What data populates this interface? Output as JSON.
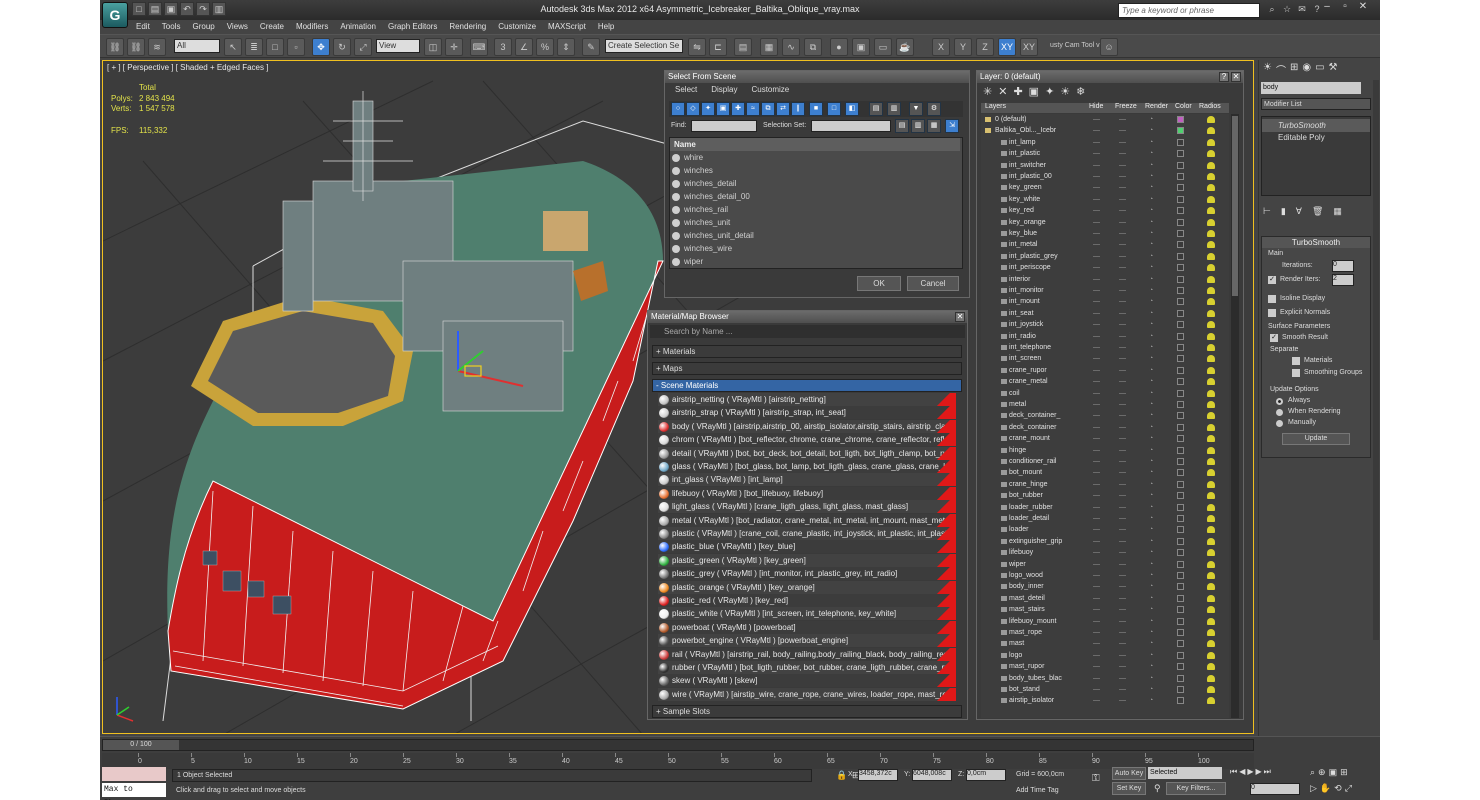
{
  "app": {
    "title": "Autodesk 3ds Max  2012 x64    Asymmetric_Icebreaker_Baltika_Oblique_vray.max",
    "search_placeholder": "Type a keyword or phrase",
    "logo": "3ds-max-logo"
  },
  "menu": [
    "Edit",
    "Tools",
    "Group",
    "Views",
    "Create",
    "Modifiers",
    "Animation",
    "Graph Editors",
    "Rendering",
    "Customize",
    "MAXScript",
    "Help"
  ],
  "toolbar": {
    "filter": "All",
    "view": "View",
    "selection_set": "Create Selection Se",
    "cam_tool": "usty Cam Tool v"
  },
  "viewport": {
    "label": "[ + ] [ Perspective ] [ Shaded + Edged Faces ]",
    "total_label": "Total",
    "polys_label": "Polys:",
    "polys": "2 843 494",
    "verts_label": "Verts:",
    "verts": "1 547 578",
    "fps_label": "FPS:",
    "fps": "115,332"
  },
  "select_from_scene": {
    "title": "Select From Scene",
    "menus": [
      "Select",
      "Display",
      "Customize"
    ],
    "find_label": "Find:",
    "selection_set_label": "Selection Set:",
    "column": "Name",
    "items": [
      "whire",
      "winches",
      "winches_detail",
      "winches_detail_00",
      "winches_rail",
      "winches_unit",
      "winches_unit_detail",
      "winches_wire",
      "wiper"
    ],
    "ok": "OK",
    "cancel": "Cancel"
  },
  "material_browser": {
    "title": "Material/Map Browser",
    "search": "Search by Name ...",
    "groups": [
      "+ Materials",
      "+ Maps",
      "- Scene Materials"
    ],
    "items": [
      "airstrip_netting  ( VRayMtl ) [airstrip_netting]",
      "airstrip_strap  ( VRayMtl ) [airstrip_strap, int_seat]",
      "body  ( VRayMtl ) [airstrip,airstrip_00, airstip_isolator,airstip_stairs, airstrip_clam...",
      "chrom  ( VRayMtl ) [bot_reflector, chrome, crane_chrome, crane_reflector, refle...",
      "detail  ( VRayMtl ) [bot, bot_deck, bot_detail, bot_ligth, bot_ligth_clamp, bot_ru...",
      "glass  ( VRayMtl ) [bot_glass, bot_lamp, bot_ligth_glass, crane_glass, crane_lam...",
      "int_glass  ( VRayMtl ) [int_lamp]",
      "lifebuoy  ( VRayMtl ) [bot_lifebuoy, lifebuoy]",
      "light_glass  ( VRayMtl ) [crane_ligth_glass, light_glass, mast_glass]",
      "metal  ( VRayMtl ) [bot_radiator, crane_metal, int_metal, int_mount, mast_meta...",
      "plastic  ( VRayMtl ) [crane_coil, crane_plastic, int_joystick, int_plastic, int_plastic...",
      "plastic_blue  ( VRayMtl ) [key_blue]",
      "plastic_green  ( VRayMtl ) [key_green]",
      "plastic_grey  ( VRayMtl ) [int_monitor, int_plastic_grey, int_radio]",
      "plastic_orange  ( VRayMtl ) [key_orange]",
      "plastic_red  ( VRayMtl ) [key_red]",
      "plastic_white  ( VRayMtl ) [int_screen, int_telephone, key_white]",
      "powerboat  ( VRayMtl ) [powerboat]",
      "powerbot_engine  ( VRayMtl ) [powerboat_engine]",
      "rail  ( VRayMtl ) [airstrip_rail, body_railing,body_railing_black, body_railing_red,...",
      "rubber  ( VRayMtl ) [bot_ligth_rubber, bot_rubber, crane_ligth_rubber, crane_ru...",
      "skew  ( VRayMtl ) [skew]",
      "wire  ( VRayMtl ) [airstip_wire, crane_rope, crane_wires, loader_rope, mast_rop..."
    ],
    "sample_slots": "+ Sample Slots"
  },
  "layer_manager": {
    "title": "Layer: 0 (default)",
    "columns": [
      "Layers",
      "Hide",
      "Freeze",
      "Render",
      "Color",
      "Radios"
    ],
    "root": [
      "0 (default)",
      "Baltika_Obl..._Icebr"
    ],
    "items": [
      "int_lamp",
      "int_plastic",
      "int_switcher",
      "int_plastic_00",
      "key_green",
      "key_white",
      "key_red",
      "key_orange",
      "key_blue",
      "int_metal",
      "int_plastic_grey",
      "int_periscope",
      "interior",
      "int_monitor",
      "int_mount",
      "int_seat",
      "int_joystick",
      "int_radio",
      "int_telephone",
      "int_screen",
      "crane_rupor",
      "crane_metal",
      "coil",
      "metal",
      "deck_container_",
      "deck_container",
      "crane_mount",
      "hinge",
      "conditioner_rail",
      "bot_mount",
      "crane_hinge",
      "bot_rubber",
      "loader_rubber",
      "loader_detail",
      "loader",
      "extinguisher_grip",
      "lifebuoy",
      "wiper",
      "logo_wood",
      "body_inner",
      "mast_deteil",
      "mast_stairs",
      "lifebuoy_mount",
      "mast_rope",
      "mast",
      "logo",
      "mast_rupor",
      "body_tubes_blac",
      "bot_stand",
      "airstip_isolator"
    ]
  },
  "command_panel": {
    "object_name": "body",
    "modifier_list": "Modifier List",
    "stack": [
      "TurboSmooth",
      "Editable Poly"
    ],
    "rollout": "TurboSmooth",
    "main": "Main",
    "iterations_label": "Iterations:",
    "iterations": "0",
    "render_iters_label": "Render Iters:",
    "render_iters": "2",
    "isoline": "Isoline Display",
    "explicit": "Explicit Normals",
    "surface": "Surface Parameters",
    "smooth": "Smooth Result",
    "separate": "Separate",
    "materials": "Materials",
    "smoothing_groups": "Smoothing Groups",
    "update_options": "Update Options",
    "always": "Always",
    "when_rendering": "When Rendering",
    "manually": "Manually",
    "update": "Update"
  },
  "status": {
    "frame": "0 / 100",
    "maxscript": "Max to Physc.",
    "selected": "1 Object Selected",
    "prompt": "Click and drag to select and move objects",
    "x_label": "X:",
    "x": "3458,372c",
    "y_label": "Y:",
    "y": "6048,008c",
    "z_label": "Z:",
    "z": "0,0cm",
    "grid": "Grid = 600,0cm",
    "add_time_tag": "Add Time Tag",
    "auto_key": "Auto Key",
    "set_key": "Set Key",
    "selected_dd": "Selected",
    "key_filters": "Key Filters...",
    "frame_field": "0"
  },
  "timeline_ticks": [
    "0",
    "5",
    "10",
    "15",
    "20",
    "25",
    "30",
    "35",
    "40",
    "45",
    "50",
    "55",
    "60",
    "65",
    "70",
    "75",
    "80",
    "85",
    "90",
    "95",
    "100"
  ]
}
